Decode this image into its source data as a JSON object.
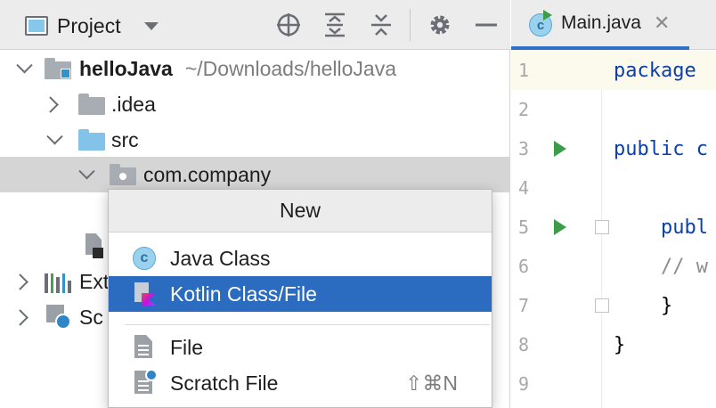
{
  "project_panel": {
    "title": "Project",
    "tree": [
      {
        "label": "helloJava",
        "path": "~/Downloads/helloJava"
      },
      {
        "label": ".idea"
      },
      {
        "label": "src"
      },
      {
        "label": "com.company"
      },
      {
        "label": "Ext"
      },
      {
        "label": "Sc"
      }
    ]
  },
  "context_menu": {
    "title": "New",
    "items": [
      {
        "label": "Java Class",
        "icon": "java-class-icon"
      },
      {
        "label": "Kotlin Class/File",
        "icon": "kotlin-file-icon",
        "selected": true
      },
      {
        "label": "File",
        "icon": "file-icon"
      },
      {
        "label": "Scratch File",
        "icon": "scratch-file-icon",
        "shortcut": "⇧⌘N"
      }
    ]
  },
  "editor": {
    "tab": {
      "label": "Main.java",
      "close": "✕"
    },
    "lines": [
      {
        "num": "1",
        "code": "package"
      },
      {
        "num": "2",
        "code": ""
      },
      {
        "num": "3",
        "code": "public c"
      },
      {
        "num": "4",
        "code": ""
      },
      {
        "num": "5",
        "code": "    publ"
      },
      {
        "num": "6",
        "code": "    // w"
      },
      {
        "num": "7",
        "code": "    }"
      },
      {
        "num": "8",
        "code": "}"
      },
      {
        "num": "9",
        "code": ""
      }
    ]
  },
  "colors": {
    "selection": "#2c6cc0",
    "run_marker": "#3b9c4a",
    "keyword": "#0c3fa8",
    "tab_underline": "#2e72c7"
  }
}
